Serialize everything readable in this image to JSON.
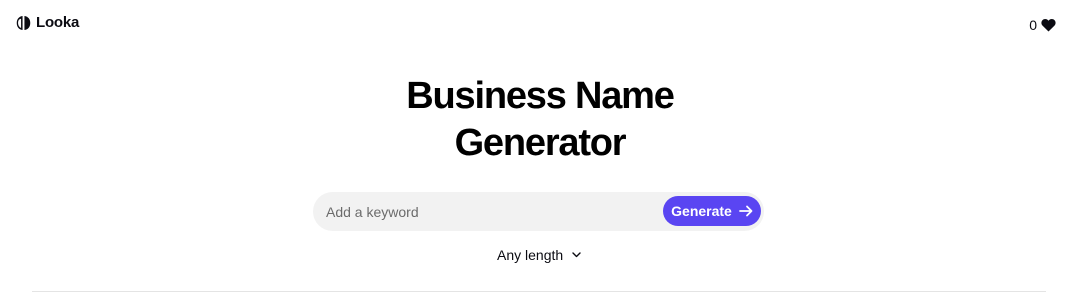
{
  "header": {
    "logo_text": "Looka",
    "favorites_count": "0"
  },
  "hero": {
    "title_line1": "Business Name",
    "title_line2": "Generator"
  },
  "search": {
    "placeholder": "Add a keyword",
    "value": "",
    "button_label": "Generate"
  },
  "filters": {
    "length_selected": "Any length"
  },
  "colors": {
    "accent": "#5a45f2",
    "text": "#0b0b12",
    "input_bg": "#f2f2f2"
  },
  "icons": {
    "logo": "looka-logo-icon",
    "favorites": "heart-icon",
    "generate": "arrow-right-icon",
    "length": "chevron-down-icon"
  }
}
